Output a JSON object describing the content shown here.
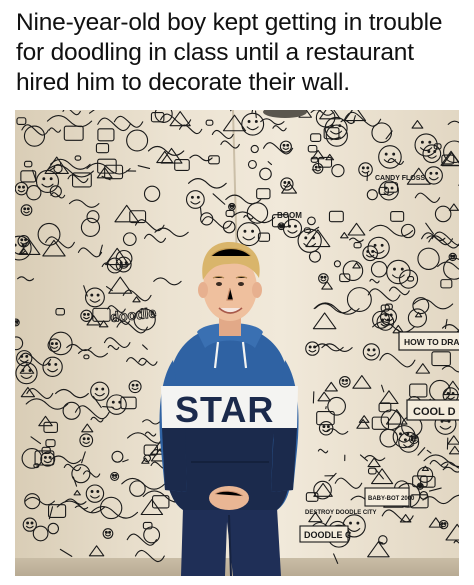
{
  "meme": {
    "caption": "Nine-year-old boy kept getting in trouble for doodling in class until a restaurant hired him to decorate their wall."
  },
  "photo": {
    "subject": "boy-standing-in-front-of-doodled-wall",
    "wall_color": "#ebe2d0",
    "ink_color": "#1a1a1a",
    "hoodie_colors": {
      "blue": "#2f62a3",
      "navy": "#1b2a4c",
      "white": "#f4f4f2"
    },
    "wall_text": {
      "candy_floss": "CANDY FLOSS",
      "boom": "BOOM",
      "how_to_draw": "HOW TO DRA",
      "cool": "COOL D",
      "baby_bot": "BABY-BOT 2000",
      "destroy": "DESTROY DOODLE CITY",
      "doodle": "DOODLE C",
      "hoodie_star": "STAR"
    }
  }
}
